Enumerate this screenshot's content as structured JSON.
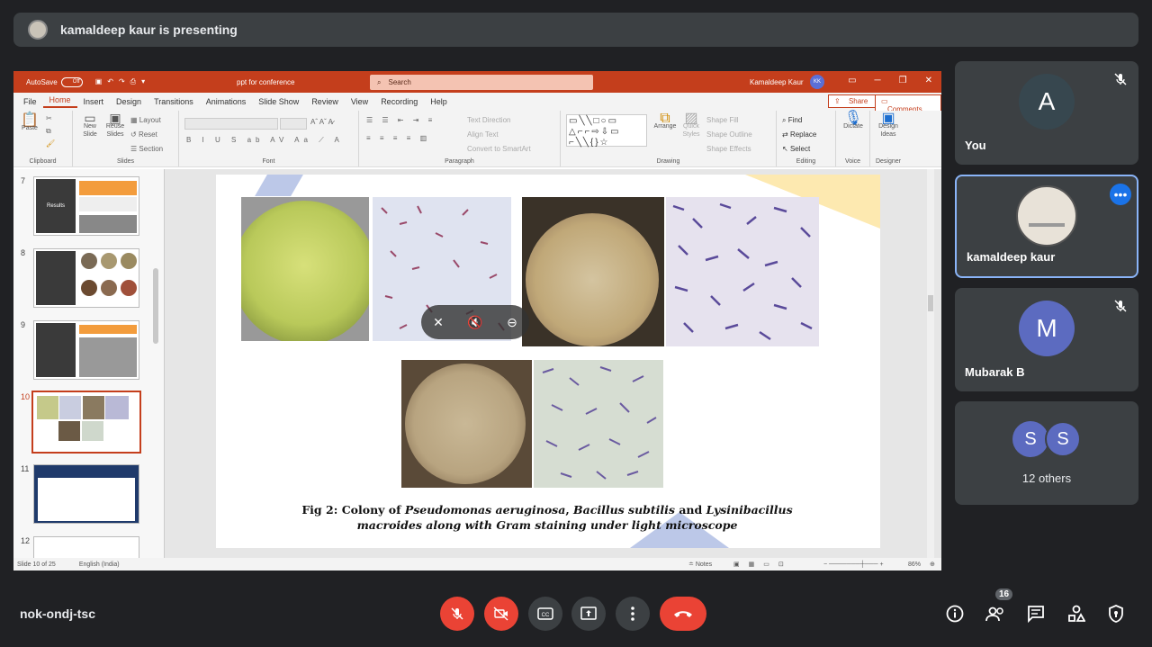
{
  "presenting_bar": {
    "text": "kamaldeep kaur is presenting"
  },
  "ppt": {
    "autosave": "AutoSave",
    "autosave_state": "Off",
    "doc_title": "ppt for conference",
    "search_placeholder": "Search",
    "user": "Kamaldeep Kaur",
    "user_initials": "KK",
    "menu": [
      "File",
      "Home",
      "Insert",
      "Design",
      "Transitions",
      "Animations",
      "Slide Show",
      "Review",
      "View",
      "Recording",
      "Help"
    ],
    "active_menu": "Home",
    "share": "Share",
    "comments": "Comments",
    "ribbon": {
      "clipboard": {
        "label": "Clipboard",
        "paste": "Paste"
      },
      "slides": {
        "label": "Slides",
        "new_slide": "New Slide",
        "reuse_slides": "Reuse Slides",
        "layout": "Layout",
        "reset": "Reset",
        "section": "Section"
      },
      "font": {
        "label": "Font"
      },
      "paragraph": {
        "label": "Paragraph",
        "text_direction": "Text Direction",
        "align_text": "Align Text",
        "convert_smartart": "Convert to SmartArt"
      },
      "drawing": {
        "label": "Drawing",
        "arrange": "Arrange",
        "quick_styles": "Quick Styles",
        "shape_fill": "Shape Fill",
        "shape_outline": "Shape Outline",
        "shape_effects": "Shape Effects"
      },
      "editing": {
        "label": "Editing",
        "find": "Find",
        "replace": "Replace",
        "select": "Select"
      },
      "voice": {
        "label": "Voice",
        "dictate": "Dictate"
      },
      "designer": {
        "label": "Designer",
        "design_ideas": "Design Ideas"
      }
    },
    "thumbnails": [
      {
        "num": "7",
        "title": "Results"
      },
      {
        "num": "8"
      },
      {
        "num": "9"
      },
      {
        "num": "10"
      },
      {
        "num": "11"
      },
      {
        "num": "12"
      }
    ],
    "slide": {
      "caption_1": "Fig 2: Colony of ",
      "caption_2": "Pseudomonas aeruginosa",
      "caption_3": ", ",
      "caption_4": "Bacillus subtilis",
      "caption_5": " and ",
      "caption_6": "Lysinibacillus",
      "caption_7": "macroides",
      "caption_8": " along with Gram staining under light microscope"
    },
    "status": {
      "slide": "Slide 10 of 25",
      "language": "English (India)",
      "notes": "Notes",
      "zoom": "86%"
    }
  },
  "participants": [
    {
      "name": "You",
      "initial": "A",
      "color": "#37474f",
      "muted": true
    },
    {
      "name": "kamaldeep kaur",
      "active": true
    },
    {
      "name": "Mubarak B",
      "initial": "M",
      "color": "#5c6bc0",
      "muted": true
    },
    {
      "name": "12 others",
      "initials": [
        "S",
        "S"
      ]
    }
  ],
  "bottom": {
    "meeting_code": "nok-ondj-tsc",
    "people_count": "16"
  },
  "colors": {
    "accent": "#c43e1c",
    "meet_red": "#ea4335",
    "meet_bg": "#202124",
    "tile": "#3c4043"
  }
}
